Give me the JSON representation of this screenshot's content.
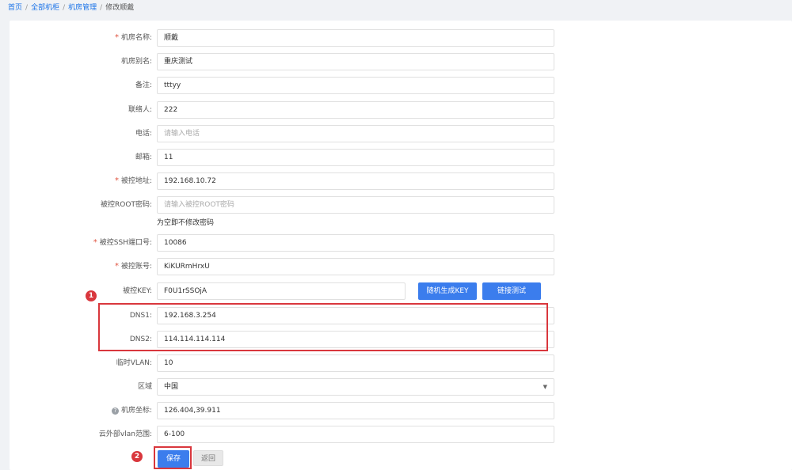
{
  "breadcrumb": {
    "items": [
      "首页",
      "全部机柜",
      "机房管理"
    ],
    "current": "修改顺戴",
    "separator": "/"
  },
  "form": {
    "room_name": {
      "label": "机房名称:",
      "required": true,
      "value": "顺戴"
    },
    "room_alias": {
      "label": "机房别名:",
      "value": "重庆测试"
    },
    "remark": {
      "label": "备注:",
      "value": "tttyy"
    },
    "contact": {
      "label": "联络人:",
      "value": "222"
    },
    "phone": {
      "label": "电话:",
      "value": "",
      "placeholder": "请输入电话"
    },
    "email": {
      "label": "邮箱:",
      "value": "11"
    },
    "controlled_address": {
      "label": "被控地址:",
      "required": true,
      "value": "192.168.10.72"
    },
    "root_password": {
      "label": "被控ROOT密码:",
      "value": "",
      "placeholder": "请输入被控ROOT密码"
    },
    "password_hint": "为空即不修改密码",
    "ssh_port": {
      "label": "被控SSH端口号:",
      "required": true,
      "value": "10086"
    },
    "account": {
      "label": "被控账号:",
      "required": true,
      "value": "KiKURmHrxU"
    },
    "key": {
      "label": "被控KEY:",
      "value": "F0U1rSSOjA"
    },
    "random_key_button": "随机生成KEY",
    "link_test_button": "链接测试",
    "dns1": {
      "label": "DNS1:",
      "value": "192.168.3.254"
    },
    "dns2": {
      "label": "DNS2:",
      "value": "114.114.114.114"
    },
    "temp_vlan": {
      "label": "临时VLAN:",
      "value": "10"
    },
    "region": {
      "label": "区域",
      "value": "中国"
    },
    "coordinates": {
      "label": "机房坐标:",
      "value": "126.404,39.911"
    },
    "vlan_range": {
      "label": "云外部vlan范围:",
      "value": "6-100"
    },
    "save_button": "保存",
    "back_button": "返回"
  },
  "annotations": {
    "badge_1": "1",
    "badge_2": "2",
    "color": "#d9373d"
  },
  "colors": {
    "primary": "#3b7ded",
    "required": "#e0533f",
    "link": "#1a73e8"
  },
  "icons": {
    "help": "question-circle-icon",
    "select_caret": "caret-down-icon"
  }
}
